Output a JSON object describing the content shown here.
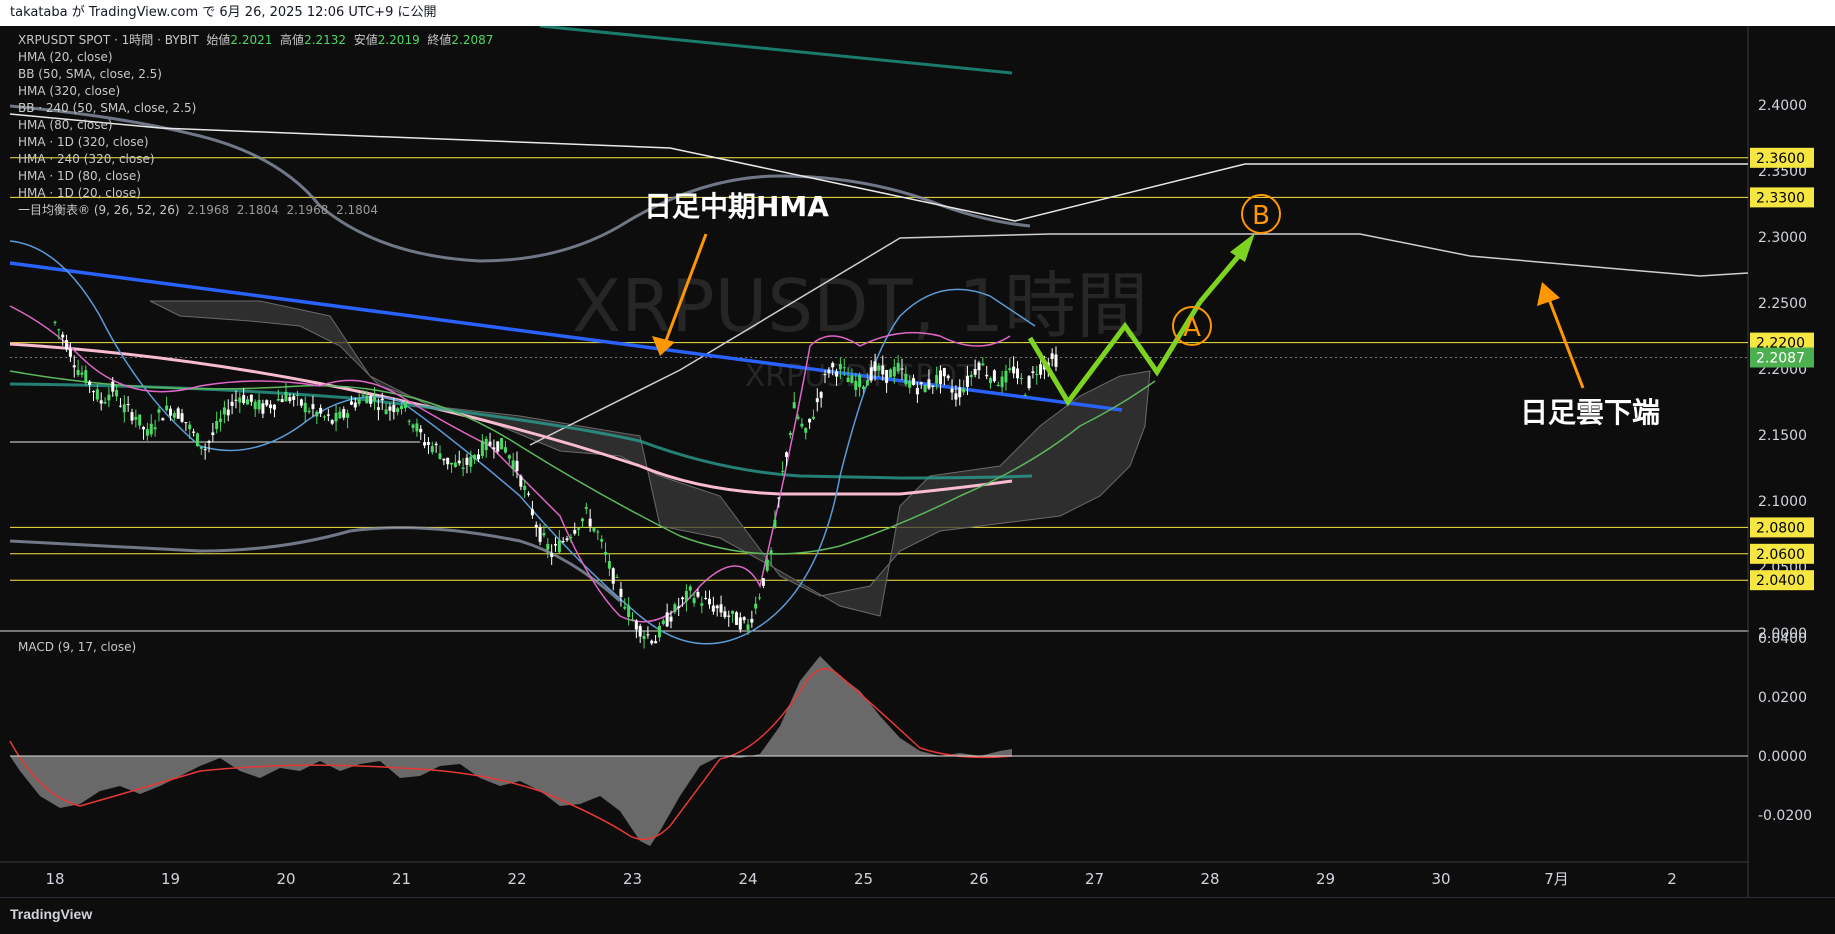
{
  "topbar": {
    "text": "takataba が TradingView.com で 6月 26, 2025 12:06 UTC+9 に公開"
  },
  "branding": {
    "logo": "TradingView"
  },
  "legend": {
    "symbol": "XRPUSDT SPOT · 1時間 · BYBIT",
    "open_label": "始値",
    "open": "2.2021",
    "high_label": "高値",
    "high": "2.2132",
    "low_label": "安値",
    "low": "2.2019",
    "close_label": "終値",
    "close": "2.2087",
    "indicators": [
      "HMA (20, close)",
      "BB (50, SMA, close, 2.5)",
      "HMA (320, close)",
      "BB · 240 (50, SMA, close, 2.5)",
      "HMA (80, close)",
      "HMA · 1D (320, close)",
      "HMA · 240 (320, close)",
      "HMA · 1D (80, close)",
      "HMA · 1D (20, close)"
    ],
    "ichimoku_label": "一目均衡表® (9, 26, 52, 26)",
    "ichimoku_values": [
      "2.1968",
      "2.1804",
      "2.1968",
      "2.1804"
    ]
  },
  "watermark": {
    "main": "XRPUSDT, 1時間",
    "sub": "XRPUSDT SPOT"
  },
  "annotations": {
    "hma_label": "日足中期HMA",
    "cloud_label": "日足雲下端",
    "point_a": "A",
    "point_b": "B"
  },
  "macd": {
    "label": "MACD (9, 17, close)"
  },
  "colors": {
    "bg": "#0d0d0d",
    "up": "#4cd964",
    "down": "#ffffff",
    "level": "#f5e642",
    "current": "#4caf50",
    "blue_hma": "#2962ff",
    "pink_hma": "#f8bbd0",
    "teal_hma": "#26a69a",
    "green_path": "#7ed321",
    "orange": "#ff9800"
  },
  "chart_data": {
    "type": "candlestick",
    "price_axis": {
      "min": 2.0,
      "max": 2.4,
      "ticks": [
        "2.4000",
        "2.3500",
        "2.3000",
        "2.2500",
        "2.2000",
        "2.1500",
        "2.1000",
        "2.0500",
        "2.0000"
      ]
    },
    "time_axis": {
      "labels": [
        "18",
        "19",
        "20",
        "21",
        "22",
        "23",
        "24",
        "25",
        "26",
        "27",
        "28",
        "29",
        "30",
        "7月",
        "2"
      ]
    },
    "current_price": "2.2087",
    "levels": [
      {
        "price": 2.36,
        "label": "2.3600"
      },
      {
        "price": 2.33,
        "label": "2.3300"
      },
      {
        "price": 2.22,
        "label": "2.2200"
      },
      {
        "price": 2.08,
        "label": "2.0800"
      },
      {
        "price": 2.06,
        "label": "2.0600"
      },
      {
        "price": 2.04,
        "label": "2.0400"
      }
    ],
    "candle_path": [
      [
        0,
        2.235
      ],
      [
        0.1,
        2.22
      ],
      [
        0.2,
        2.2
      ],
      [
        0.3,
        2.19
      ],
      [
        0.4,
        2.175
      ],
      [
        0.5,
        2.185
      ],
      [
        0.6,
        2.17
      ],
      [
        0.7,
        2.165
      ],
      [
        0.8,
        2.15
      ],
      [
        0.9,
        2.165
      ],
      [
        1.0,
        2.17
      ],
      [
        1.1,
        2.165
      ],
      [
        1.2,
        2.15
      ],
      [
        1.3,
        2.14
      ],
      [
        1.4,
        2.155
      ],
      [
        1.5,
        2.17
      ],
      [
        1.6,
        2.18
      ],
      [
        1.7,
        2.175
      ],
      [
        1.8,
        2.17
      ],
      [
        1.9,
        2.175
      ],
      [
        2.0,
        2.18
      ],
      [
        2.1,
        2.175
      ],
      [
        2.2,
        2.17
      ],
      [
        2.3,
        2.165
      ],
      [
        2.4,
        2.16
      ],
      [
        2.5,
        2.165
      ],
      [
        2.6,
        2.175
      ],
      [
        2.7,
        2.18
      ],
      [
        2.8,
        2.175
      ],
      [
        2.9,
        2.17
      ],
      [
        3.0,
        2.175
      ],
      [
        3.1,
        2.16
      ],
      [
        3.2,
        2.145
      ],
      [
        3.3,
        2.14
      ],
      [
        3.4,
        2.13
      ],
      [
        3.5,
        2.125
      ],
      [
        3.6,
        2.13
      ],
      [
        3.7,
        2.14
      ],
      [
        3.8,
        2.145
      ],
      [
        3.9,
        2.14
      ],
      [
        4.0,
        2.125
      ],
      [
        4.1,
        2.1
      ],
      [
        4.2,
        2.075
      ],
      [
        4.3,
        2.06
      ],
      [
        4.4,
        2.07
      ],
      [
        4.5,
        2.08
      ],
      [
        4.6,
        2.09
      ],
      [
        4.7,
        2.075
      ],
      [
        4.8,
        2.05
      ],
      [
        4.9,
        2.03
      ],
      [
        5.0,
        2.01
      ],
      [
        5.1,
        2.0
      ],
      [
        5.2,
        1.995
      ],
      [
        5.3,
        2.01
      ],
      [
        5.4,
        2.02
      ],
      [
        5.5,
        2.03
      ],
      [
        5.6,
        2.025
      ],
      [
        5.7,
        2.02
      ],
      [
        5.8,
        2.015
      ],
      [
        5.9,
        2.01
      ],
      [
        6.0,
        2.005
      ],
      [
        6.1,
        2.03
      ],
      [
        6.2,
        2.06
      ],
      [
        6.3,
        2.12
      ],
      [
        6.4,
        2.17
      ],
      [
        6.5,
        2.15
      ],
      [
        6.6,
        2.175
      ],
      [
        6.7,
        2.2
      ],
      [
        6.8,
        2.2
      ],
      [
        6.9,
        2.19
      ],
      [
        7.0,
        2.19
      ],
      [
        7.1,
        2.2
      ],
      [
        7.2,
        2.195
      ],
      [
        7.3,
        2.2
      ],
      [
        7.4,
        2.19
      ],
      [
        7.5,
        2.185
      ],
      [
        7.6,
        2.19
      ],
      [
        7.7,
        2.195
      ],
      [
        7.8,
        2.18
      ],
      [
        7.9,
        2.19
      ],
      [
        8.0,
        2.205
      ],
      [
        8.1,
        2.195
      ],
      [
        8.2,
        2.19
      ],
      [
        8.3,
        2.2
      ],
      [
        8.4,
        2.185
      ],
      [
        8.5,
        2.2
      ],
      [
        8.6,
        2.205
      ],
      [
        8.7,
        2.2087
      ]
    ],
    "macd_axis": {
      "ticks": [
        "0.0400",
        "0.0200",
        "0.0000",
        "-0.0200"
      ]
    }
  }
}
